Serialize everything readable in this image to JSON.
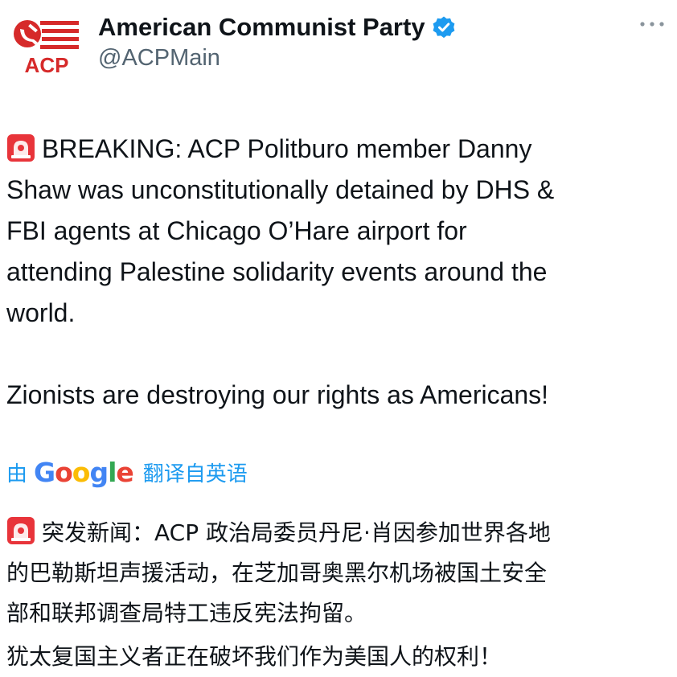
{
  "account": {
    "display_name": "American Communist Party",
    "handle": "@ACPMain",
    "avatar_text": "ACP",
    "verified": true
  },
  "tweet": {
    "paragraph1": "BREAKING: ACP Politburo member Danny\nShaw was unconstitutionally detained by DHS &\nFBI agents at Chicago O’Hare airport for\nattending Palestine solidarity events around the\nworld.",
    "paragraph2": "Zionists are destroying our rights as Americans!"
  },
  "translation": {
    "prefix": "由",
    "provider_logo": [
      "G",
      "o",
      "o",
      "g",
      "l",
      "e"
    ],
    "suffix": "翻译自英语",
    "paragraph1": "突发新闻：ACP 政治局委员丹尼·肖因参加世界各地\n的巴勒斯坦声援活动，在芝加哥奥黑尔机场被国土安全\n部和联邦调查局特工违反宪法拘留。",
    "paragraph2": "犹太复国主义者正在破坏我们作为美国人的权利！"
  },
  "icons": {
    "siren": "siren-emoji-icon",
    "verified": "verified-badge-icon",
    "more": "more-options-icon"
  },
  "colors": {
    "brand_red": "#d62a2a",
    "verified_blue": "#1d9bf0",
    "handle_gray": "#536471",
    "link_blue": "#1d9bf0"
  }
}
